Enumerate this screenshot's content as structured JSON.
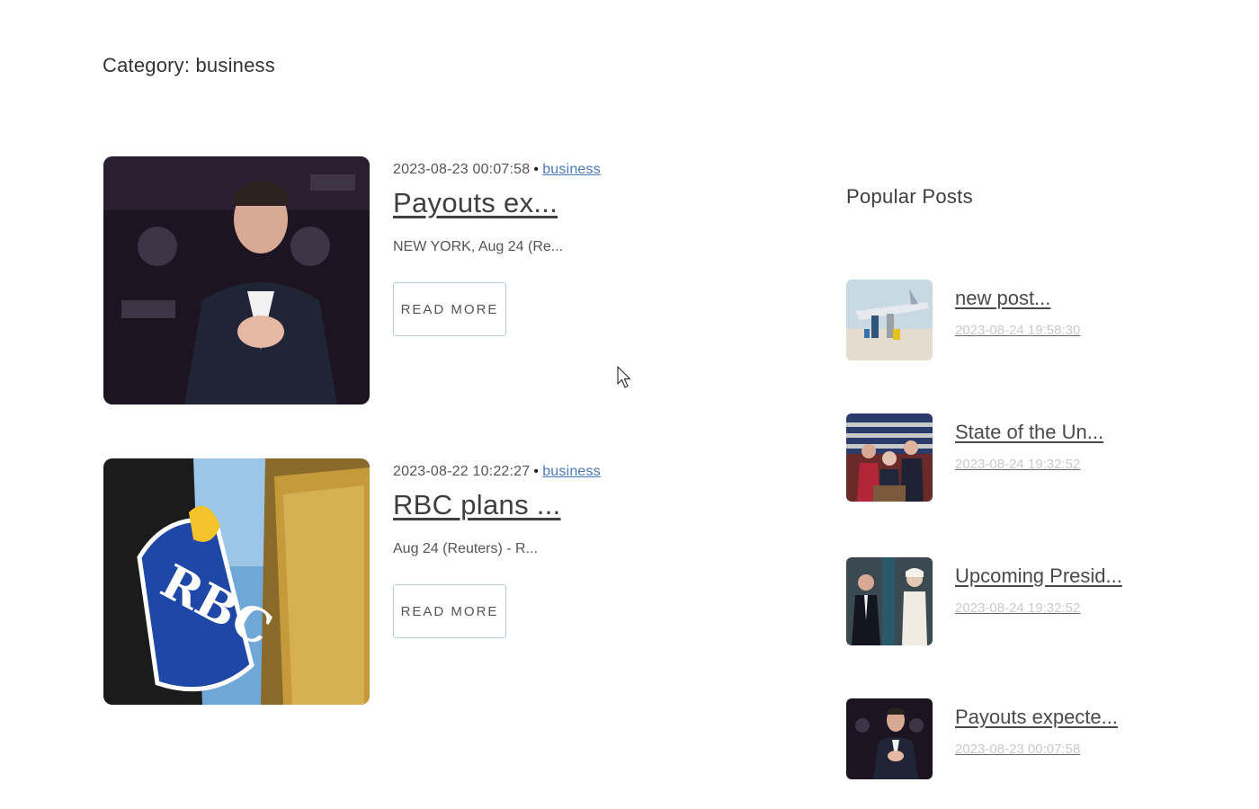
{
  "page": {
    "category_heading": "Category: business"
  },
  "posts": [
    {
      "date": "2023-08-23 00:07:58",
      "category": "business",
      "title": "Payouts ex...",
      "excerpt": "NEW YORK, Aug 24 (Re...",
      "button_label": "READ MORE",
      "thumb_icon": "portrait-photo"
    },
    {
      "date": "2023-08-22 10:22:27",
      "category": "business",
      "title": "RBC plans ...",
      "excerpt": "Aug 24 (Reuters) - R...",
      "button_label": "READ MORE",
      "thumb_icon": "rbc-building-photo",
      "thumb_logo_text": "RBC"
    }
  ],
  "sidebar": {
    "title": "Popular Posts",
    "items": [
      {
        "title": "new post...",
        "date": "2023-08-24 19:58:30",
        "thumb_icon": "airplane-photo"
      },
      {
        "title": "State of the Un...",
        "date": "2023-08-24 19:32:52",
        "thumb_icon": "state-of-union-photo"
      },
      {
        "title": "Upcoming Presid...",
        "date": "2023-08-24 19:32:52",
        "thumb_icon": "presidential-couple-photo"
      },
      {
        "title": "Payouts expecte...",
        "date": "2023-08-23 00:07:58",
        "thumb_icon": "portrait-photo"
      }
    ]
  },
  "colors": {
    "link": "#4a78b8",
    "text": "#3f3f3f",
    "button_border": "#b7cbd6",
    "date_muted": "#c9c9c9"
  }
}
